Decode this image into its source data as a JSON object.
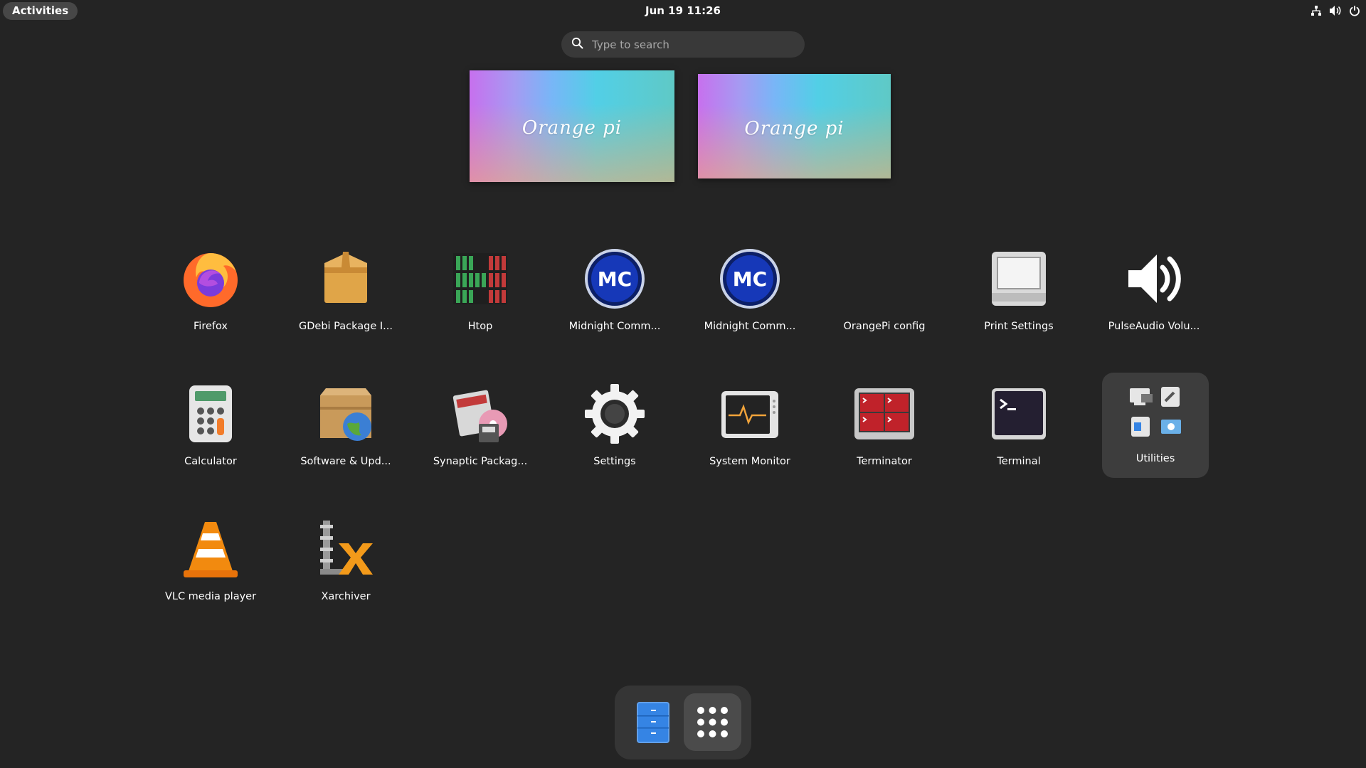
{
  "topbar": {
    "activities_label": "Activities",
    "clock": "Jun 19  11:26",
    "tray_icons": [
      "network-icon",
      "volume-icon",
      "power-icon"
    ]
  },
  "search": {
    "placeholder": "Type to search"
  },
  "workspaces": [
    {
      "logo_text": "Orange pi"
    },
    {
      "logo_text": "Orange pi"
    }
  ],
  "apps": [
    {
      "label": "Firefox",
      "icon": "firefox-icon"
    },
    {
      "label": "GDebi Package I...",
      "icon": "package-box-icon"
    },
    {
      "label": "Htop",
      "icon": "htop-icon"
    },
    {
      "label": "Midnight Comm...",
      "icon": "midnight-commander-icon"
    },
    {
      "label": "Midnight Comm...",
      "icon": "midnight-commander-icon"
    },
    {
      "label": "OrangePi config",
      "icon": "blank-icon"
    },
    {
      "label": "Print Settings",
      "icon": "printer-icon"
    },
    {
      "label": "PulseAudio Volu...",
      "icon": "speaker-icon"
    },
    {
      "label": "Calculator",
      "icon": "calculator-icon"
    },
    {
      "label": "Software & Upd...",
      "icon": "software-update-icon"
    },
    {
      "label": "Synaptic Packag...",
      "icon": "synaptic-icon"
    },
    {
      "label": "Settings",
      "icon": "gear-icon"
    },
    {
      "label": "System Monitor",
      "icon": "system-monitor-icon"
    },
    {
      "label": "Terminator",
      "icon": "terminator-icon"
    },
    {
      "label": "Terminal",
      "icon": "terminal-icon"
    },
    {
      "label": "Utilities",
      "icon": "utilities-folder-icon"
    },
    {
      "label": "VLC media player",
      "icon": "vlc-cone-icon"
    },
    {
      "label": "Xarchiver",
      "icon": "xarchiver-icon"
    }
  ],
  "dash": {
    "items": [
      "files-icon",
      "show-apps-icon"
    ]
  },
  "colors": {
    "background": "#242424",
    "folder_bg": "#3d3d3d",
    "accent_blue": "#3584e4"
  }
}
